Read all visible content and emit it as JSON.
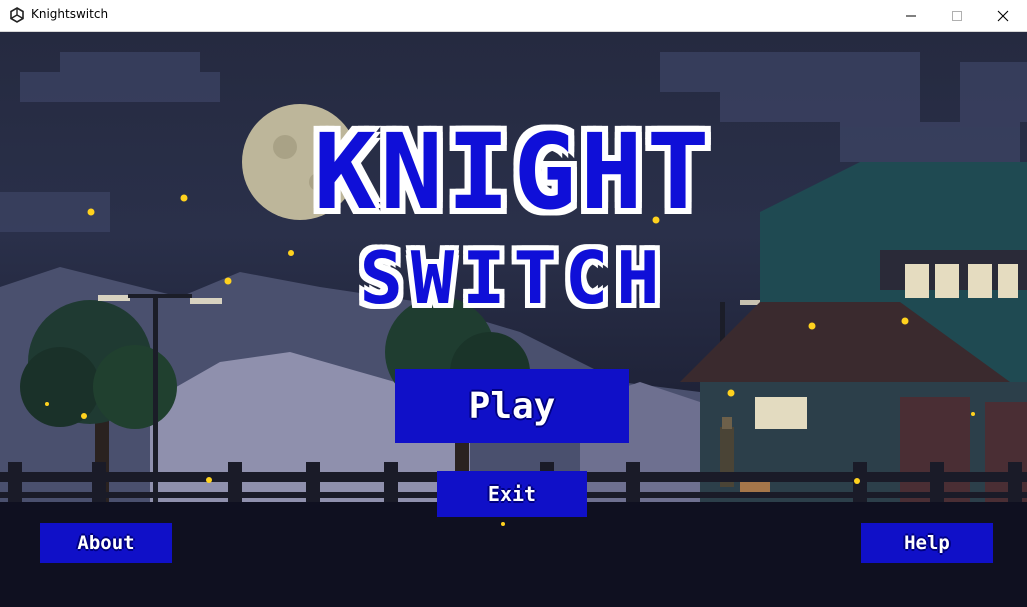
{
  "window": {
    "title": "Knightswitch",
    "app_icon": "unity-icon",
    "controls": [
      "minimize-icon",
      "maximize-icon",
      "close-icon"
    ]
  },
  "game": {
    "logo_line1": "KNIGHT",
    "logo_line2": "SWITCH",
    "play_label": "Play",
    "exit_label": "Exit",
    "about_label": "About",
    "help_label": "Help",
    "colors": {
      "button_blue": "#1010c8",
      "logo_blue": "#0f0fd8",
      "logo_outline": "#ffffff",
      "sky": "#252a40",
      "firefly": "#ffd21e"
    }
  }
}
